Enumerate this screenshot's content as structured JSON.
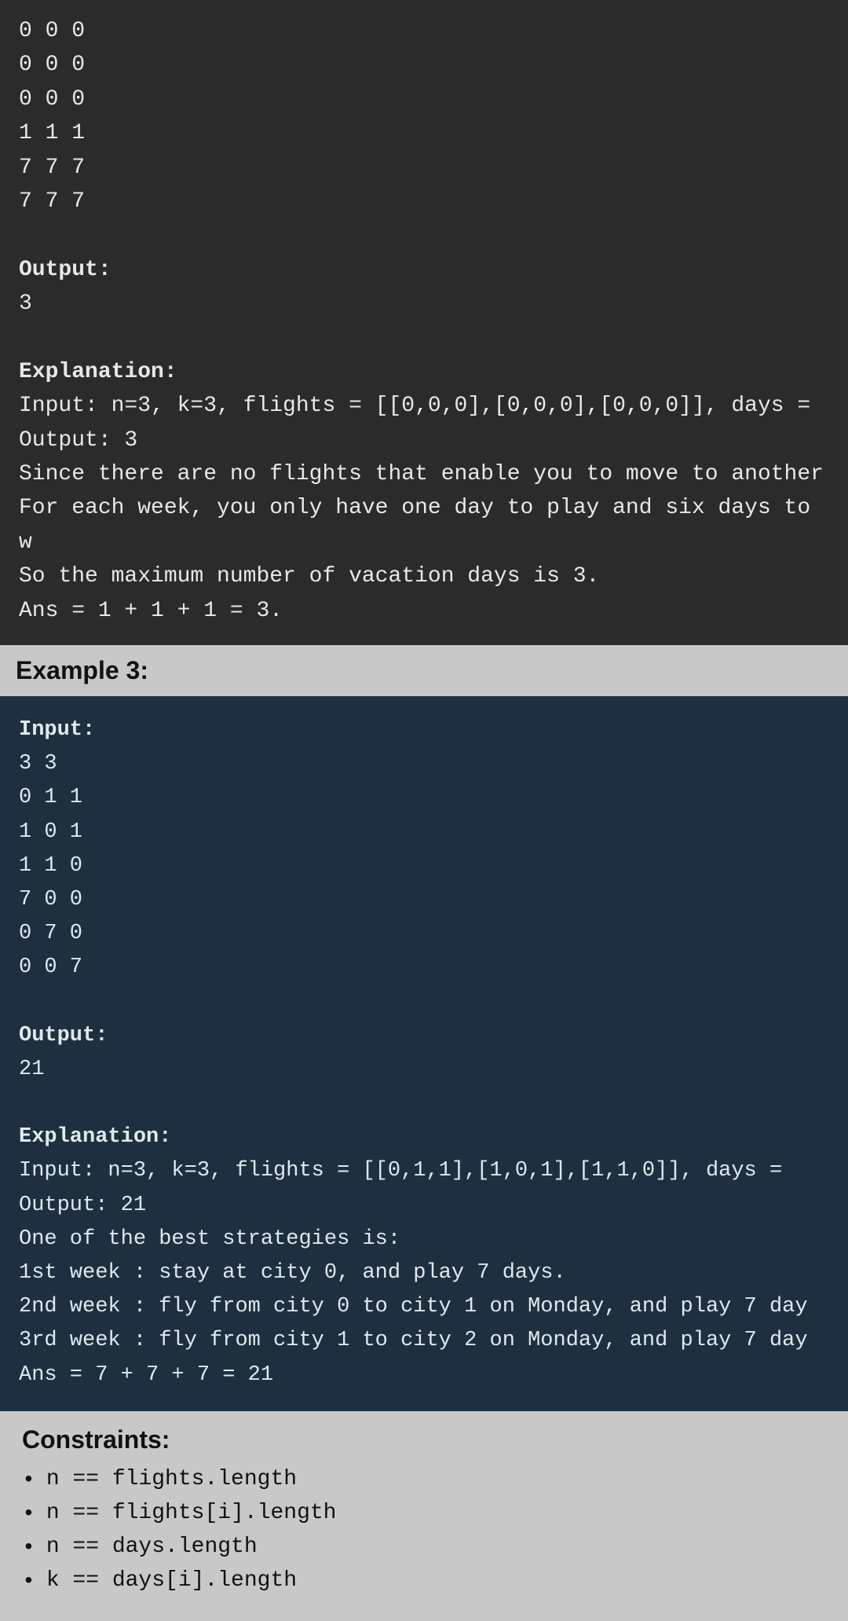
{
  "top_block": {
    "code_lines": [
      "0 0 0",
      "0 0 0",
      "0 0 0",
      "1 1 1",
      "7 7 7",
      "7 7 7"
    ],
    "output_label": "Output:",
    "output_value": "3",
    "explanation_label": "Explanation:",
    "explanation_lines": [
      "Input: n=3, k=3, flights = [[0,0,0],[0,0,0],[0,0,0]], days =",
      "Output: 3",
      "Since there are no flights that enable you to move to another",
      "For each week, you only have one day to play and six days to w",
      "So the maximum number of vacation days is 3.",
      "Ans = 1 + 1 + 1 = 3."
    ]
  },
  "example3_header": "Example 3:",
  "example3_block": {
    "input_label": "Input:",
    "input_lines": [
      "3 3",
      "0 1 1",
      "1 0 1",
      "1 1 0",
      "7 0 0",
      "0 7 0",
      "0 0 7"
    ],
    "output_label": "Output:",
    "output_value": "21",
    "explanation_label": "Explanation:",
    "explanation_lines": [
      "Input: n=3, k=3, flights = [[0,1,1],[1,0,1],[1,1,0]], days =",
      "Output: 21",
      "One of the best strategies is:",
      "1st week : stay at city 0, and play 7 days.",
      "2nd week : fly from city 0 to city 1 on Monday, and play 7 day",
      "3rd week : fly from city 1 to city 2 on Monday, and play 7 day",
      "Ans = 7 + 7 + 7 = 21"
    ]
  },
  "constraints_title": "Constraints:",
  "constraints": [
    {
      "text": "n == flights.length"
    },
    {
      "text": "n == flights[i].length"
    },
    {
      "text": "n == days.length"
    },
    {
      "text": "k == days[i].length"
    }
  ]
}
